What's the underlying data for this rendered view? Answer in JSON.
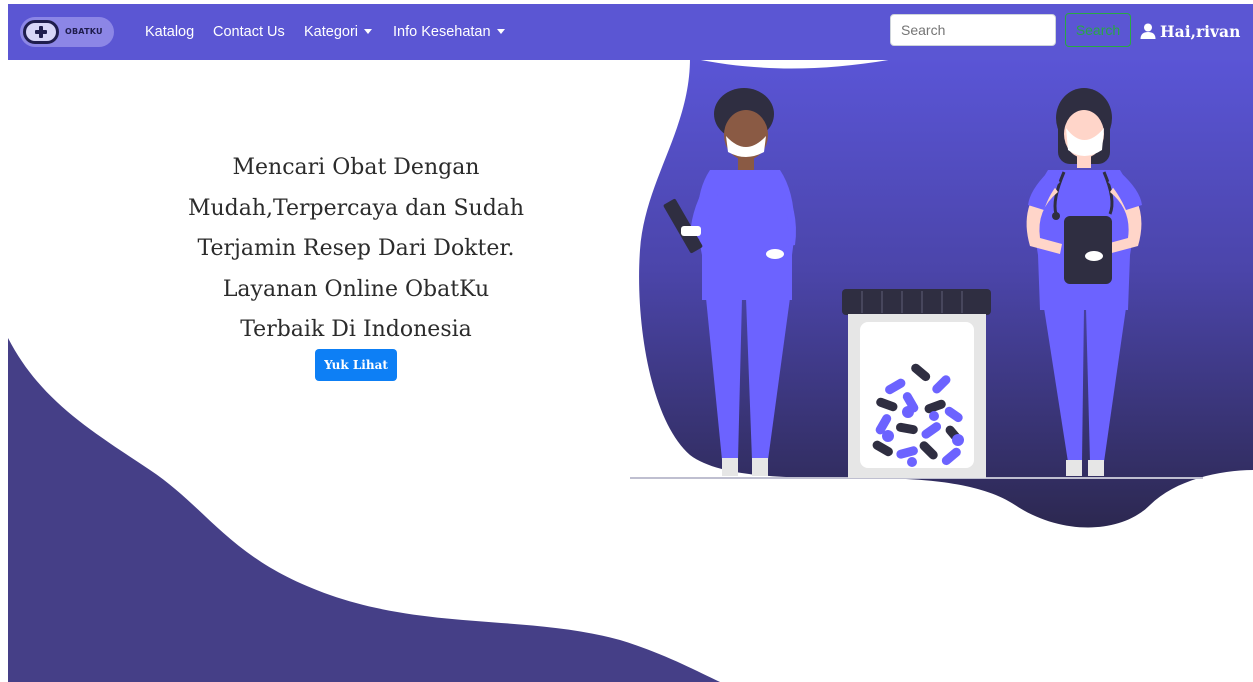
{
  "brand": {
    "logo_text": "OBATKU"
  },
  "nav": {
    "links": [
      {
        "label": "Katalog"
      },
      {
        "label": "Contact Us"
      },
      {
        "label": "Kategori",
        "dropdown": true
      },
      {
        "label": "Info Kesehatan",
        "dropdown": true
      }
    ],
    "search": {
      "placeholder": "Search",
      "button_label": "Search"
    },
    "user_label": "Hai,rivan"
  },
  "hero": {
    "lines": [
      "Mencari Obat Dengan",
      "Mudah,Terpercaya dan Sudah",
      "Terjamin Resep Dari Dokter.",
      "Layanan Online ObatKu",
      "Terbaik Di Indonesia"
    ],
    "cta_label": "Yuk Lihat"
  },
  "colors": {
    "navbar": "#5b56d3",
    "wave": "#453f87",
    "blob_top": "#5a55d6",
    "blob_bottom": "#2c2850",
    "scrubs": "#6c63ff",
    "cta": "#0d7ff5",
    "search_button": "#28a745"
  },
  "icons": [
    "plus-icon",
    "caret-down-icon",
    "user-icon"
  ]
}
